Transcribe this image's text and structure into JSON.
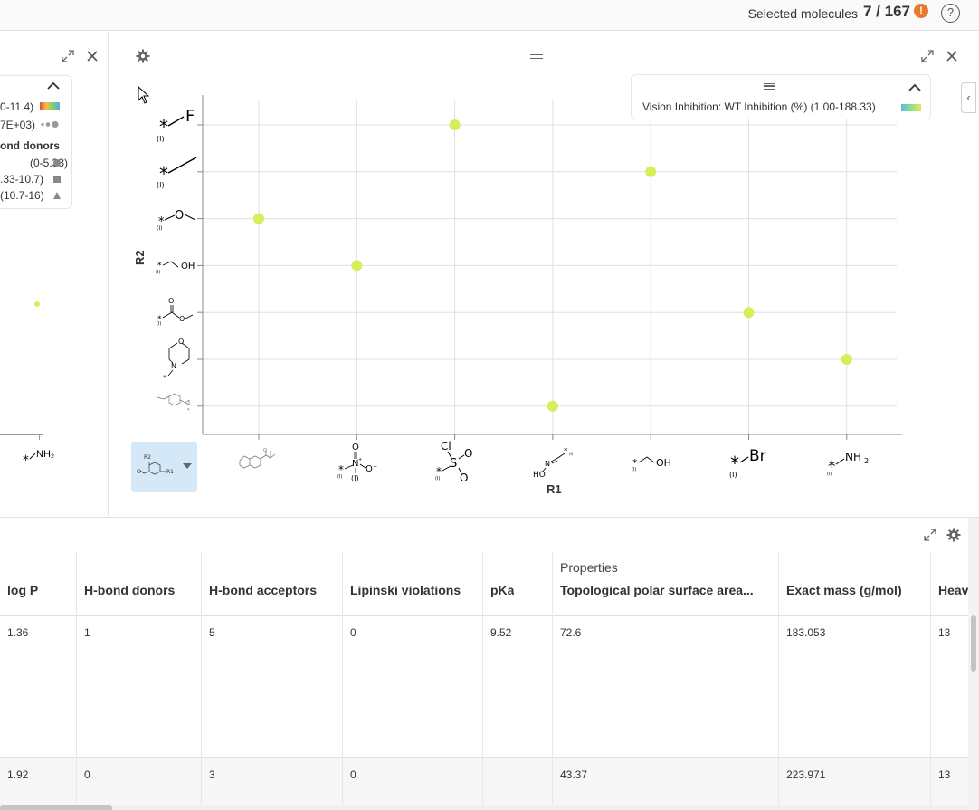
{
  "topbar": {
    "selected_label": "Selected molecules",
    "selected_count": "7 / 167",
    "alert_icon": "exclamation-icon",
    "alert_color": "#e8792f",
    "help_icon": "question-icon",
    "help_symbol": "?"
  },
  "left_panel": {
    "legend_rows": [
      "0-11.4)",
      "7E+03)",
      "ond donors",
      "(0-5.33)",
      ".33-10.7)",
      "(10.7-16)"
    ],
    "axis_r1_label": "NH₂"
  },
  "scatter": {
    "legend_title": "Vision Inhibition: WT Inhibition (%) (1.00-188.33)",
    "side_toggle_symbol": "‹",
    "point_color": "#d9ec5a",
    "x_axis_label": "R1",
    "y_axis_label": "R2",
    "r1_groups": [
      "ester-aryl",
      "nitro",
      "sulfonyl-chloride",
      "oxime",
      "hydroxymethyl",
      "bromo",
      "amino"
    ],
    "r2_groups": [
      "fluoro",
      "methyl",
      "methoxy",
      "hydroxymethyl",
      "methyl-ester",
      "morpholine",
      "aryl-ester"
    ],
    "points": [
      {
        "r1": 0,
        "r2": 2
      },
      {
        "r1": 1,
        "r2": 3
      },
      {
        "r1": 2,
        "r2": 0
      },
      {
        "r1": 3,
        "r2": 6
      },
      {
        "r1": 4,
        "r2": 1
      },
      {
        "r1": 5,
        "r2": 4
      },
      {
        "r1": 6,
        "r2": 5
      }
    ]
  },
  "table": {
    "group_header": "Properties",
    "columns": [
      "log P",
      "H-bond donors",
      "H-bond acceptors",
      "Lipinski violations",
      "pKa",
      "Topological polar surface area...",
      "Exact mass (g/mol)",
      "Heav"
    ],
    "rows": [
      [
        "1.36",
        "1",
        "5",
        "0",
        "9.52",
        "72.6",
        "183.053",
        "13"
      ],
      [
        "1.92",
        "0",
        "3",
        "0",
        "",
        "43.37",
        "223.971",
        "13"
      ]
    ]
  }
}
